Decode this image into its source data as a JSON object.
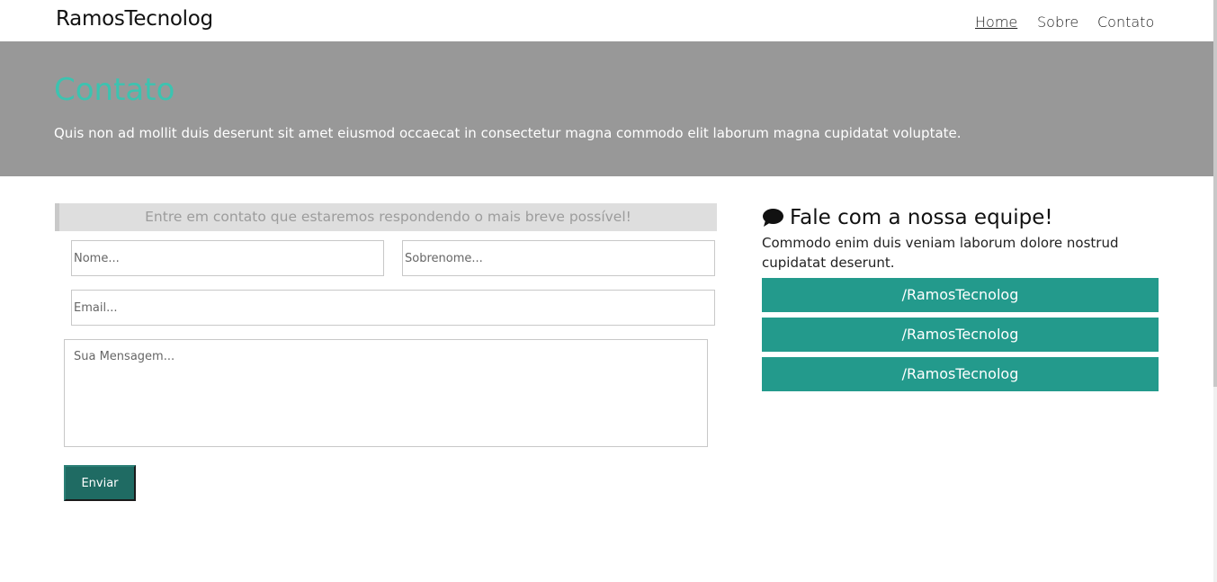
{
  "header": {
    "brand": "RamosTecnolog",
    "nav": {
      "home": "Home",
      "sobre": "Sobre",
      "contato": "Contato"
    }
  },
  "hero": {
    "title": "Contato",
    "text": "Quis non ad mollit duis deserunt sit amet eiusmod occaecat in consectetur magna commodo elit laborum magna cupidatat voluptate."
  },
  "form": {
    "heading": "Entre em contato que estaremos respondendo o mais breve possível!",
    "nome_placeholder": "Nome...",
    "sobrenome_placeholder": "Sobrenome...",
    "email_placeholder": "Email...",
    "mensagem_placeholder": "Sua Mensagem...",
    "submit_label": "Enviar"
  },
  "sidebar": {
    "title": "Fale com a nossa equipe!",
    "icon": "comment-icon",
    "text": "Commodo enim duis veniam laborum dolore nostrud cupidatat deserunt.",
    "links": [
      "/RamosTecnolog",
      "/RamosTecnolog",
      "/RamosTecnolog"
    ]
  },
  "colors": {
    "accent": "#239a8c",
    "hero_bg": "#989898",
    "hero_title": "#3cc3b0",
    "button_dark": "#1f6b63"
  }
}
